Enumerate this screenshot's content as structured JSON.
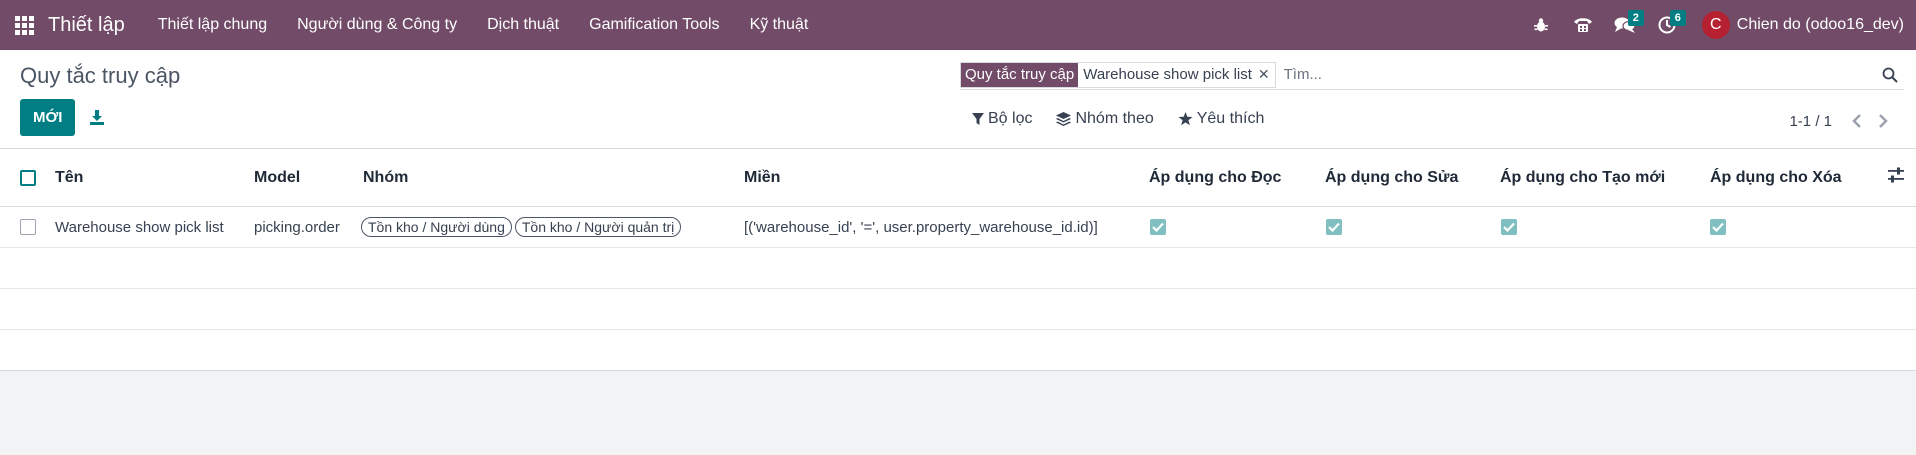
{
  "navbar": {
    "app_title": "Thiết lập",
    "menu": [
      "Thiết lập chung",
      "Người dùng & Công ty",
      "Dịch thuật",
      "Gamification Tools",
      "Kỹ thuật"
    ],
    "messages_badge": "2",
    "activities_badge": "6",
    "avatar_initial": "C",
    "avatar_color": "#b62131",
    "user_name": "Chien do (odoo16_dev)"
  },
  "control_panel": {
    "breadcrumb": "Quy tắc truy cập",
    "new_button": "MỚI",
    "search": {
      "facet_label": "Quy tắc truy cập",
      "facet_value": "Warehouse show pick list",
      "placeholder": "Tìm..."
    },
    "filters": [
      "Bộ lọc",
      "Nhóm theo",
      "Yêu thích"
    ],
    "pager": "1-1 / 1"
  },
  "list": {
    "columns": [
      "Tên",
      "Model",
      "Nhóm",
      "Miền",
      "Áp dụng cho Đọc",
      "Áp dụng cho Sửa",
      "Áp dụng cho Tạo mới",
      "Áp dụng cho Xóa"
    ],
    "rows": [
      {
        "name": "Warehouse show pick list",
        "model": "picking.order",
        "groups": [
          "Tồn kho / Người dùng",
          "Tồn kho / Người quản trị"
        ],
        "domain": "[('warehouse_id', '=', user.property_warehouse_id.id)]",
        "perm_read": true,
        "perm_write": true,
        "perm_create": true,
        "perm_unlink": true
      }
    ]
  },
  "colors": {
    "brand": "#714b67",
    "primary": "#017e84"
  }
}
